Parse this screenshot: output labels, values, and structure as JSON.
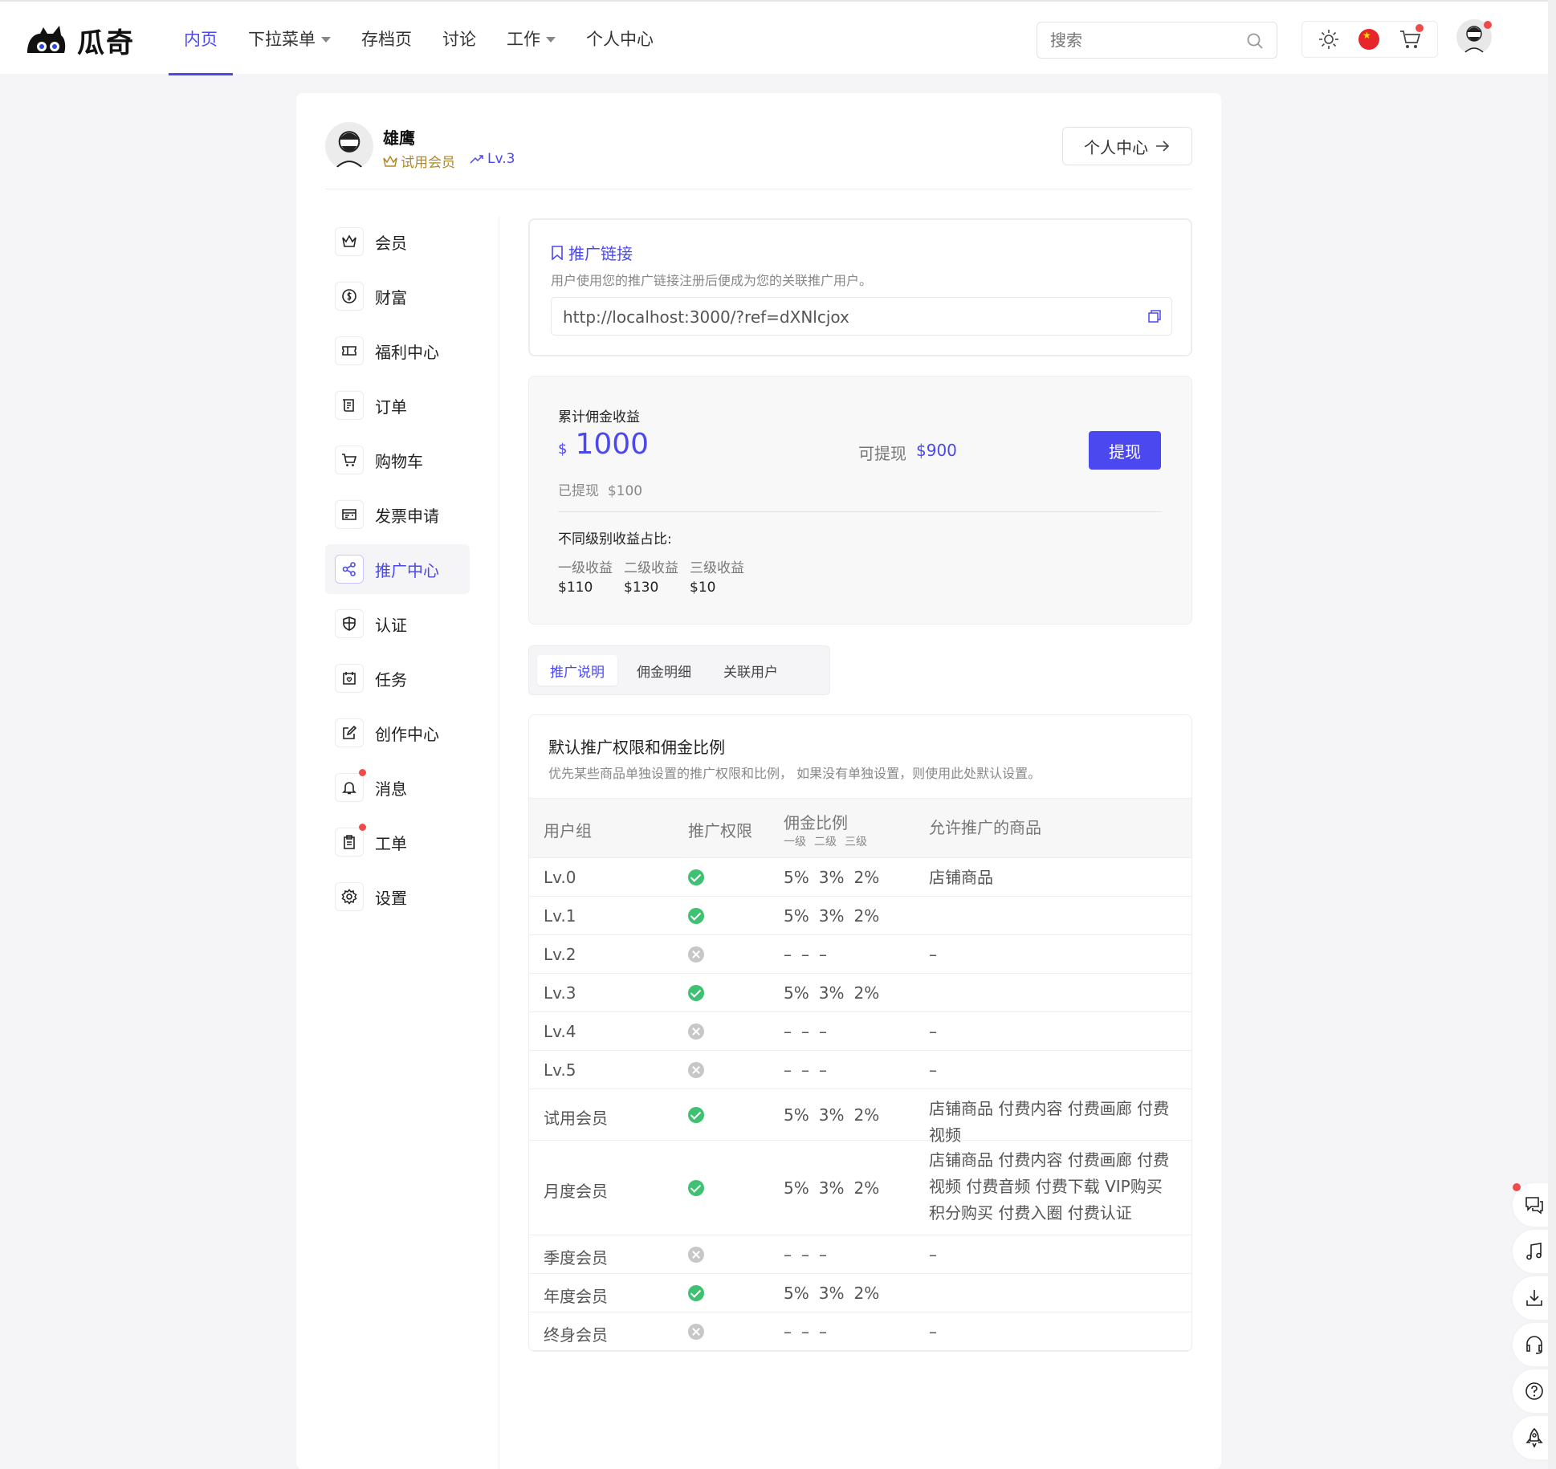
{
  "brand": {
    "name": "瓜奇"
  },
  "nav": [
    {
      "label": "内页",
      "active": true,
      "dropdown": false
    },
    {
      "label": "下拉菜单",
      "active": false,
      "dropdown": true
    },
    {
      "label": "存档页",
      "active": false,
      "dropdown": false
    },
    {
      "label": "讨论",
      "active": false,
      "dropdown": false
    },
    {
      "label": "工作",
      "active": false,
      "dropdown": true
    },
    {
      "label": "个人中心",
      "active": false,
      "dropdown": false
    }
  ],
  "search": {
    "placeholder": "搜索"
  },
  "profile": {
    "name": "雄鹰",
    "member": "试用会员",
    "level": "Lv.3",
    "center_button": "个人中心"
  },
  "sidebar": [
    {
      "label": "会员",
      "icon": "crown-icon"
    },
    {
      "label": "财富",
      "icon": "coin-icon"
    },
    {
      "label": "福利中心",
      "icon": "ticket-icon"
    },
    {
      "label": "订单",
      "icon": "receipt-icon"
    },
    {
      "label": "购物车",
      "icon": "cart-icon"
    },
    {
      "label": "发票申请",
      "icon": "invoice-icon"
    },
    {
      "label": "推广中心",
      "icon": "share-icon",
      "active": true
    },
    {
      "label": "认证",
      "icon": "shield-icon"
    },
    {
      "label": "任务",
      "icon": "calendar-icon"
    },
    {
      "label": "创作中心",
      "icon": "edit-icon"
    },
    {
      "label": "消息",
      "icon": "bell-icon",
      "dot": true
    },
    {
      "label": "工单",
      "icon": "clipboard-icon",
      "dot": true
    },
    {
      "label": "设置",
      "icon": "gear-icon"
    }
  ],
  "promo_link": {
    "title": "推广链接",
    "desc": "用户使用您的推广链接注册后便成为您的关联推广用户。",
    "url": "http://localhost:3000/?ref=dXNlcjox"
  },
  "earnings": {
    "title": "累计佣金收益",
    "currency": "$",
    "total": "1000",
    "withdrawn_label": "已提现",
    "withdrawn": "$100",
    "available_label": "可提现",
    "available": "$900",
    "withdraw_button": "提现",
    "levels_title": "不同级别收益占比:",
    "levels": [
      {
        "label": "一级收益",
        "value": "$110"
      },
      {
        "label": "二级收益",
        "value": "$130"
      },
      {
        "label": "三级收益",
        "value": "$10"
      }
    ]
  },
  "tabs": [
    {
      "label": "推广说明",
      "active": true
    },
    {
      "label": "佣金明细",
      "active": false
    },
    {
      "label": "关联用户",
      "active": false
    }
  ],
  "table": {
    "title": "默认推广权限和佣金比例",
    "subtitle": "优先某些商品单独设置的推广权限和比例， 如果没有单独设置，则使用此处默认设置。",
    "headers": {
      "group": "用户组",
      "permission": "推广权限",
      "ratio": "佣金比例",
      "ratio_sub": [
        "一级",
        "二级",
        "三级"
      ],
      "products": "允许推广的商品"
    },
    "rows": [
      {
        "group": "Lv.0",
        "ok": true,
        "rates": [
          "5%",
          "3%",
          "2%"
        ],
        "products": "店铺商品"
      },
      {
        "group": "Lv.1",
        "ok": true,
        "rates": [
          "5%",
          "3%",
          "2%"
        ],
        "products": ""
      },
      {
        "group": "Lv.2",
        "ok": false,
        "rates": [
          "–",
          "–",
          "–"
        ],
        "products": "–"
      },
      {
        "group": "Lv.3",
        "ok": true,
        "rates": [
          "5%",
          "3%",
          "2%"
        ],
        "products": ""
      },
      {
        "group": "Lv.4",
        "ok": false,
        "rates": [
          "–",
          "–",
          "–"
        ],
        "products": "–"
      },
      {
        "group": "Lv.5",
        "ok": false,
        "rates": [
          "–",
          "–",
          "–"
        ],
        "products": "–"
      },
      {
        "group": "试用会员",
        "ok": true,
        "rates": [
          "5%",
          "3%",
          "2%"
        ],
        "products": "店铺商品  付费内容  付费画廊  付费视频"
      },
      {
        "group": "月度会员",
        "ok": true,
        "rates": [
          "5%",
          "3%",
          "2%"
        ],
        "products": "店铺商品  付费内容  付费画廊  付费视频  付费音频  付费下载  VIP购买  积分购买  付费入圈  付费认证"
      },
      {
        "group": "季度会员",
        "ok": false,
        "rates": [
          "–",
          "–",
          "–"
        ],
        "products": "–"
      },
      {
        "group": "年度会员",
        "ok": true,
        "rates": [
          "5%",
          "3%",
          "2%"
        ],
        "products": ""
      },
      {
        "group": "终身会员",
        "ok": false,
        "rates": [
          "–",
          "–",
          "–"
        ],
        "products": "–"
      }
    ]
  },
  "colors": {
    "accent": "#4b48f0",
    "success": "#3ec172",
    "disabled": "#c7c7c7",
    "badge": "#f04b4b"
  }
}
